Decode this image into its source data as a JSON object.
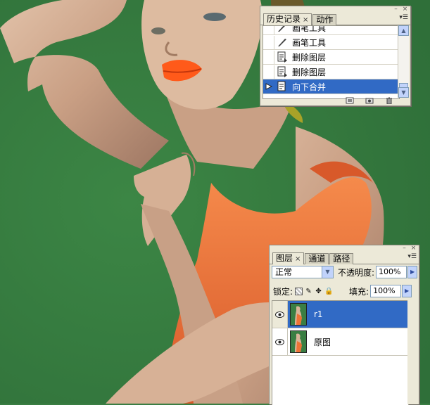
{
  "history_panel": {
    "tabs": [
      {
        "label": "历史记录",
        "close": "×",
        "active": true
      },
      {
        "label": "动作",
        "active": false
      }
    ],
    "steps": [
      {
        "label": "画笔工具",
        "icon": "brush-icon",
        "selected": false
      },
      {
        "label": "画笔工具",
        "icon": "brush-icon",
        "selected": false
      },
      {
        "label": "删除图层",
        "icon": "history-state-icon",
        "selected": false
      },
      {
        "label": "删除图层",
        "icon": "history-state-icon",
        "selected": false
      },
      {
        "label": "向下合并",
        "icon": "history-state-icon",
        "selected": true
      }
    ],
    "footer_icons": [
      "new-document-from-state-icon",
      "camera-snapshot-icon",
      "trash-icon"
    ]
  },
  "layers_panel": {
    "tabs": [
      {
        "label": "图层",
        "close": "×",
        "active": true
      },
      {
        "label": "通道",
        "active": false
      },
      {
        "label": "路径",
        "active": false
      }
    ],
    "blend_mode": "正常",
    "opacity_label": "不透明度:",
    "opacity_value": "100%",
    "lock_label": "锁定:",
    "fill_label": "填充:",
    "fill_value": "100%",
    "layers": [
      {
        "name": "r1",
        "visible": true,
        "selected": true
      },
      {
        "name": "原图",
        "visible": true,
        "selected": false
      }
    ]
  },
  "colors": {
    "background_green": "#3a7e43",
    "selection_blue": "#316ac5",
    "panel_gray": "#ece9d8",
    "dress_orange": "#ee7336",
    "lip_orange": "#ff5a1a"
  }
}
